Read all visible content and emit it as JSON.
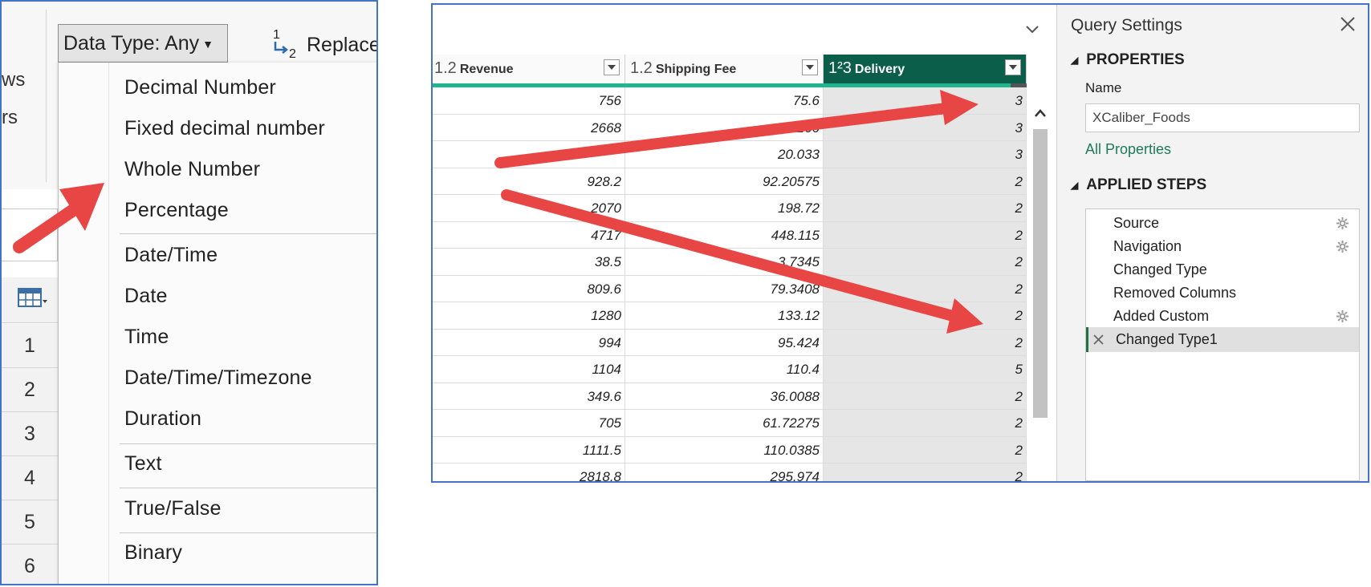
{
  "left": {
    "ribbon_cut_1": "ws",
    "ribbon_cut_2": "rs",
    "data_type_button": "Data Type: Any",
    "replace_button": "Replace",
    "menu_items": [
      "Decimal Number",
      "Fixed decimal number",
      "Whole Number",
      "Percentage",
      "Date/Time",
      "Date",
      "Time",
      "Date/Time/Timezone",
      "Duration",
      "Text",
      "True/False",
      "Binary"
    ],
    "row_numbers": [
      "1",
      "2",
      "3",
      "4",
      "5",
      "6"
    ]
  },
  "right": {
    "columns": [
      {
        "type": "1.2",
        "name": "Revenue"
      },
      {
        "type": "1.2",
        "name": "Shipping Fee"
      },
      {
        "type": "1²3",
        "name": "Delivery"
      }
    ],
    "rows": [
      [
        "756",
        "75.6",
        "3"
      ],
      [
        "2668",
        "266",
        "3"
      ],
      [
        "",
        "20.033",
        "3"
      ],
      [
        "928.2",
        "92.20575",
        "2"
      ],
      [
        "2070",
        "198.72",
        "2"
      ],
      [
        "4717",
        "448.115",
        "2"
      ],
      [
        "38.5",
        "3.7345",
        "2"
      ],
      [
        "809.6",
        "79.3408",
        "2"
      ],
      [
        "1280",
        "133.12",
        "2"
      ],
      [
        "994",
        "95.424",
        "2"
      ],
      [
        "1104",
        "110.4",
        "5"
      ],
      [
        "349.6",
        "36.0088",
        "2"
      ],
      [
        "705",
        "61.72275",
        "2"
      ],
      [
        "1111.5",
        "110.0385",
        "2"
      ],
      [
        "2818.8",
        "295.974",
        "2"
      ]
    ],
    "query_settings": {
      "title": "Query Settings",
      "properties_heading": "PROPERTIES",
      "name_label": "Name",
      "name_value": "XCaliber_Foods",
      "all_properties_link": "All Properties",
      "applied_steps_heading": "APPLIED STEPS",
      "steps": [
        {
          "label": "Source",
          "gear": true
        },
        {
          "label": "Navigation",
          "gear": true
        },
        {
          "label": "Changed Type",
          "gear": false
        },
        {
          "label": "Removed Columns",
          "gear": false
        },
        {
          "label": "Added Custom",
          "gear": true
        },
        {
          "label": "Changed Type1",
          "gear": false,
          "active": true
        }
      ]
    }
  },
  "colors": {
    "frame_border": "#4472c4",
    "header_active": "#0b5f4a",
    "quality_bar": "#1fb58f",
    "arrow": "#e84545",
    "link": "#1e7a5a"
  }
}
